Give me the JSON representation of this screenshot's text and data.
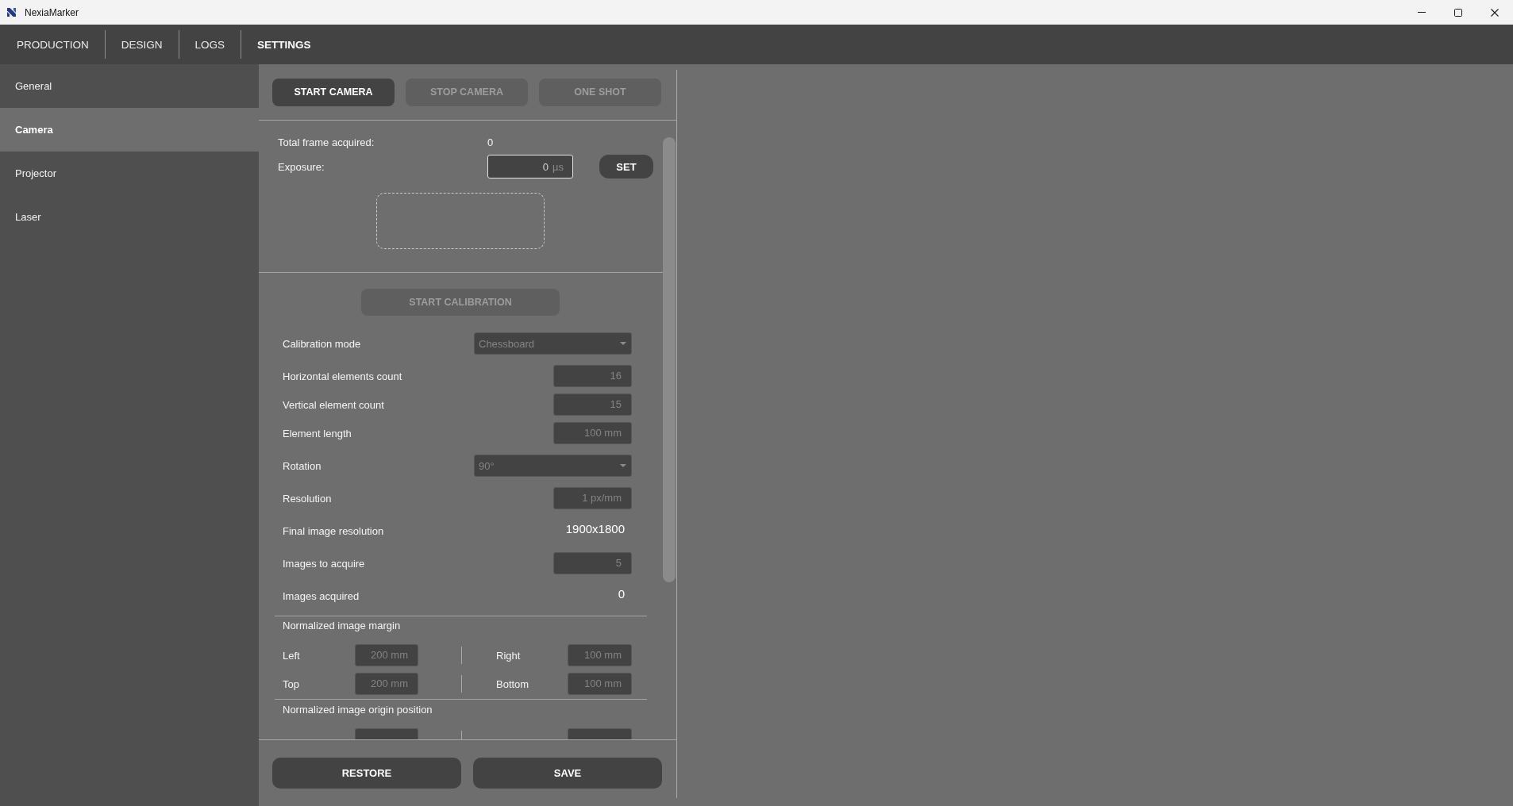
{
  "window": {
    "title": "NexiaMarker"
  },
  "tabs": [
    {
      "label": "PRODUCTION",
      "selected": false
    },
    {
      "label": "DESIGN",
      "selected": false
    },
    {
      "label": "LOGS",
      "selected": false
    },
    {
      "label": "SETTINGS",
      "selected": true
    }
  ],
  "sidebar": {
    "items": [
      {
        "label": "General",
        "selected": false
      },
      {
        "label": "Camera",
        "selected": true
      },
      {
        "label": "Projector",
        "selected": false
      },
      {
        "label": "Laser",
        "selected": false
      }
    ]
  },
  "camera_controls": {
    "buttons": [
      {
        "label": "START CAMERA",
        "disabled": false
      },
      {
        "label": "STOP CAMERA",
        "disabled": true
      },
      {
        "label": "ONE SHOT",
        "disabled": true
      }
    ]
  },
  "acquisition": {
    "total_frames": {
      "label": "Total frame acquired:",
      "value": "0"
    },
    "exposure": {
      "label": "Exposure:",
      "value": "0",
      "unit": "µs",
      "focused": true
    },
    "set_button": {
      "label": "SET"
    }
  },
  "calibration": {
    "start_button": {
      "label": "START CALIBRATION",
      "disabled": true
    },
    "fields": [
      {
        "kind": "dropdown",
        "label": "Calibration mode",
        "value": "Chessboard",
        "disabled": true
      },
      {
        "kind": "number",
        "label": "Horizontal elements count",
        "value": "16",
        "disabled": true
      },
      {
        "kind": "number",
        "label": "Vertical element count",
        "value": "15",
        "disabled": true
      },
      {
        "kind": "number",
        "label": "Element length",
        "value": "100 mm",
        "disabled": true
      },
      {
        "kind": "dropdown",
        "label": "Rotation",
        "value": "90°",
        "disabled": true
      },
      {
        "kind": "number",
        "label": "Resolution",
        "value": "1 px/mm",
        "disabled": true
      },
      {
        "kind": "readout",
        "label": "Final image resolution",
        "value": "1900x1800"
      },
      {
        "kind": "number",
        "label": "Images to acquire",
        "value": "5",
        "disabled": true
      },
      {
        "kind": "readout",
        "label": "Images acquired",
        "value": "0"
      }
    ]
  },
  "image_margin": {
    "title": "Normalized image margin",
    "rows": [
      {
        "fields": [
          {
            "label": "Left",
            "value": "200 mm",
            "disabled": true
          },
          {
            "label": "Right",
            "value": "100 mm",
            "disabled": true
          }
        ]
      },
      {
        "fields": [
          {
            "label": "Top",
            "value": "200 mm",
            "disabled": true
          },
          {
            "label": "Bottom",
            "value": "100 mm",
            "disabled": true
          }
        ]
      }
    ]
  },
  "image_origin": {
    "title": "Normalized image origin position"
  },
  "footer": {
    "buttons": [
      {
        "label": "RESTORE"
      },
      {
        "label": "SAVE"
      }
    ]
  }
}
